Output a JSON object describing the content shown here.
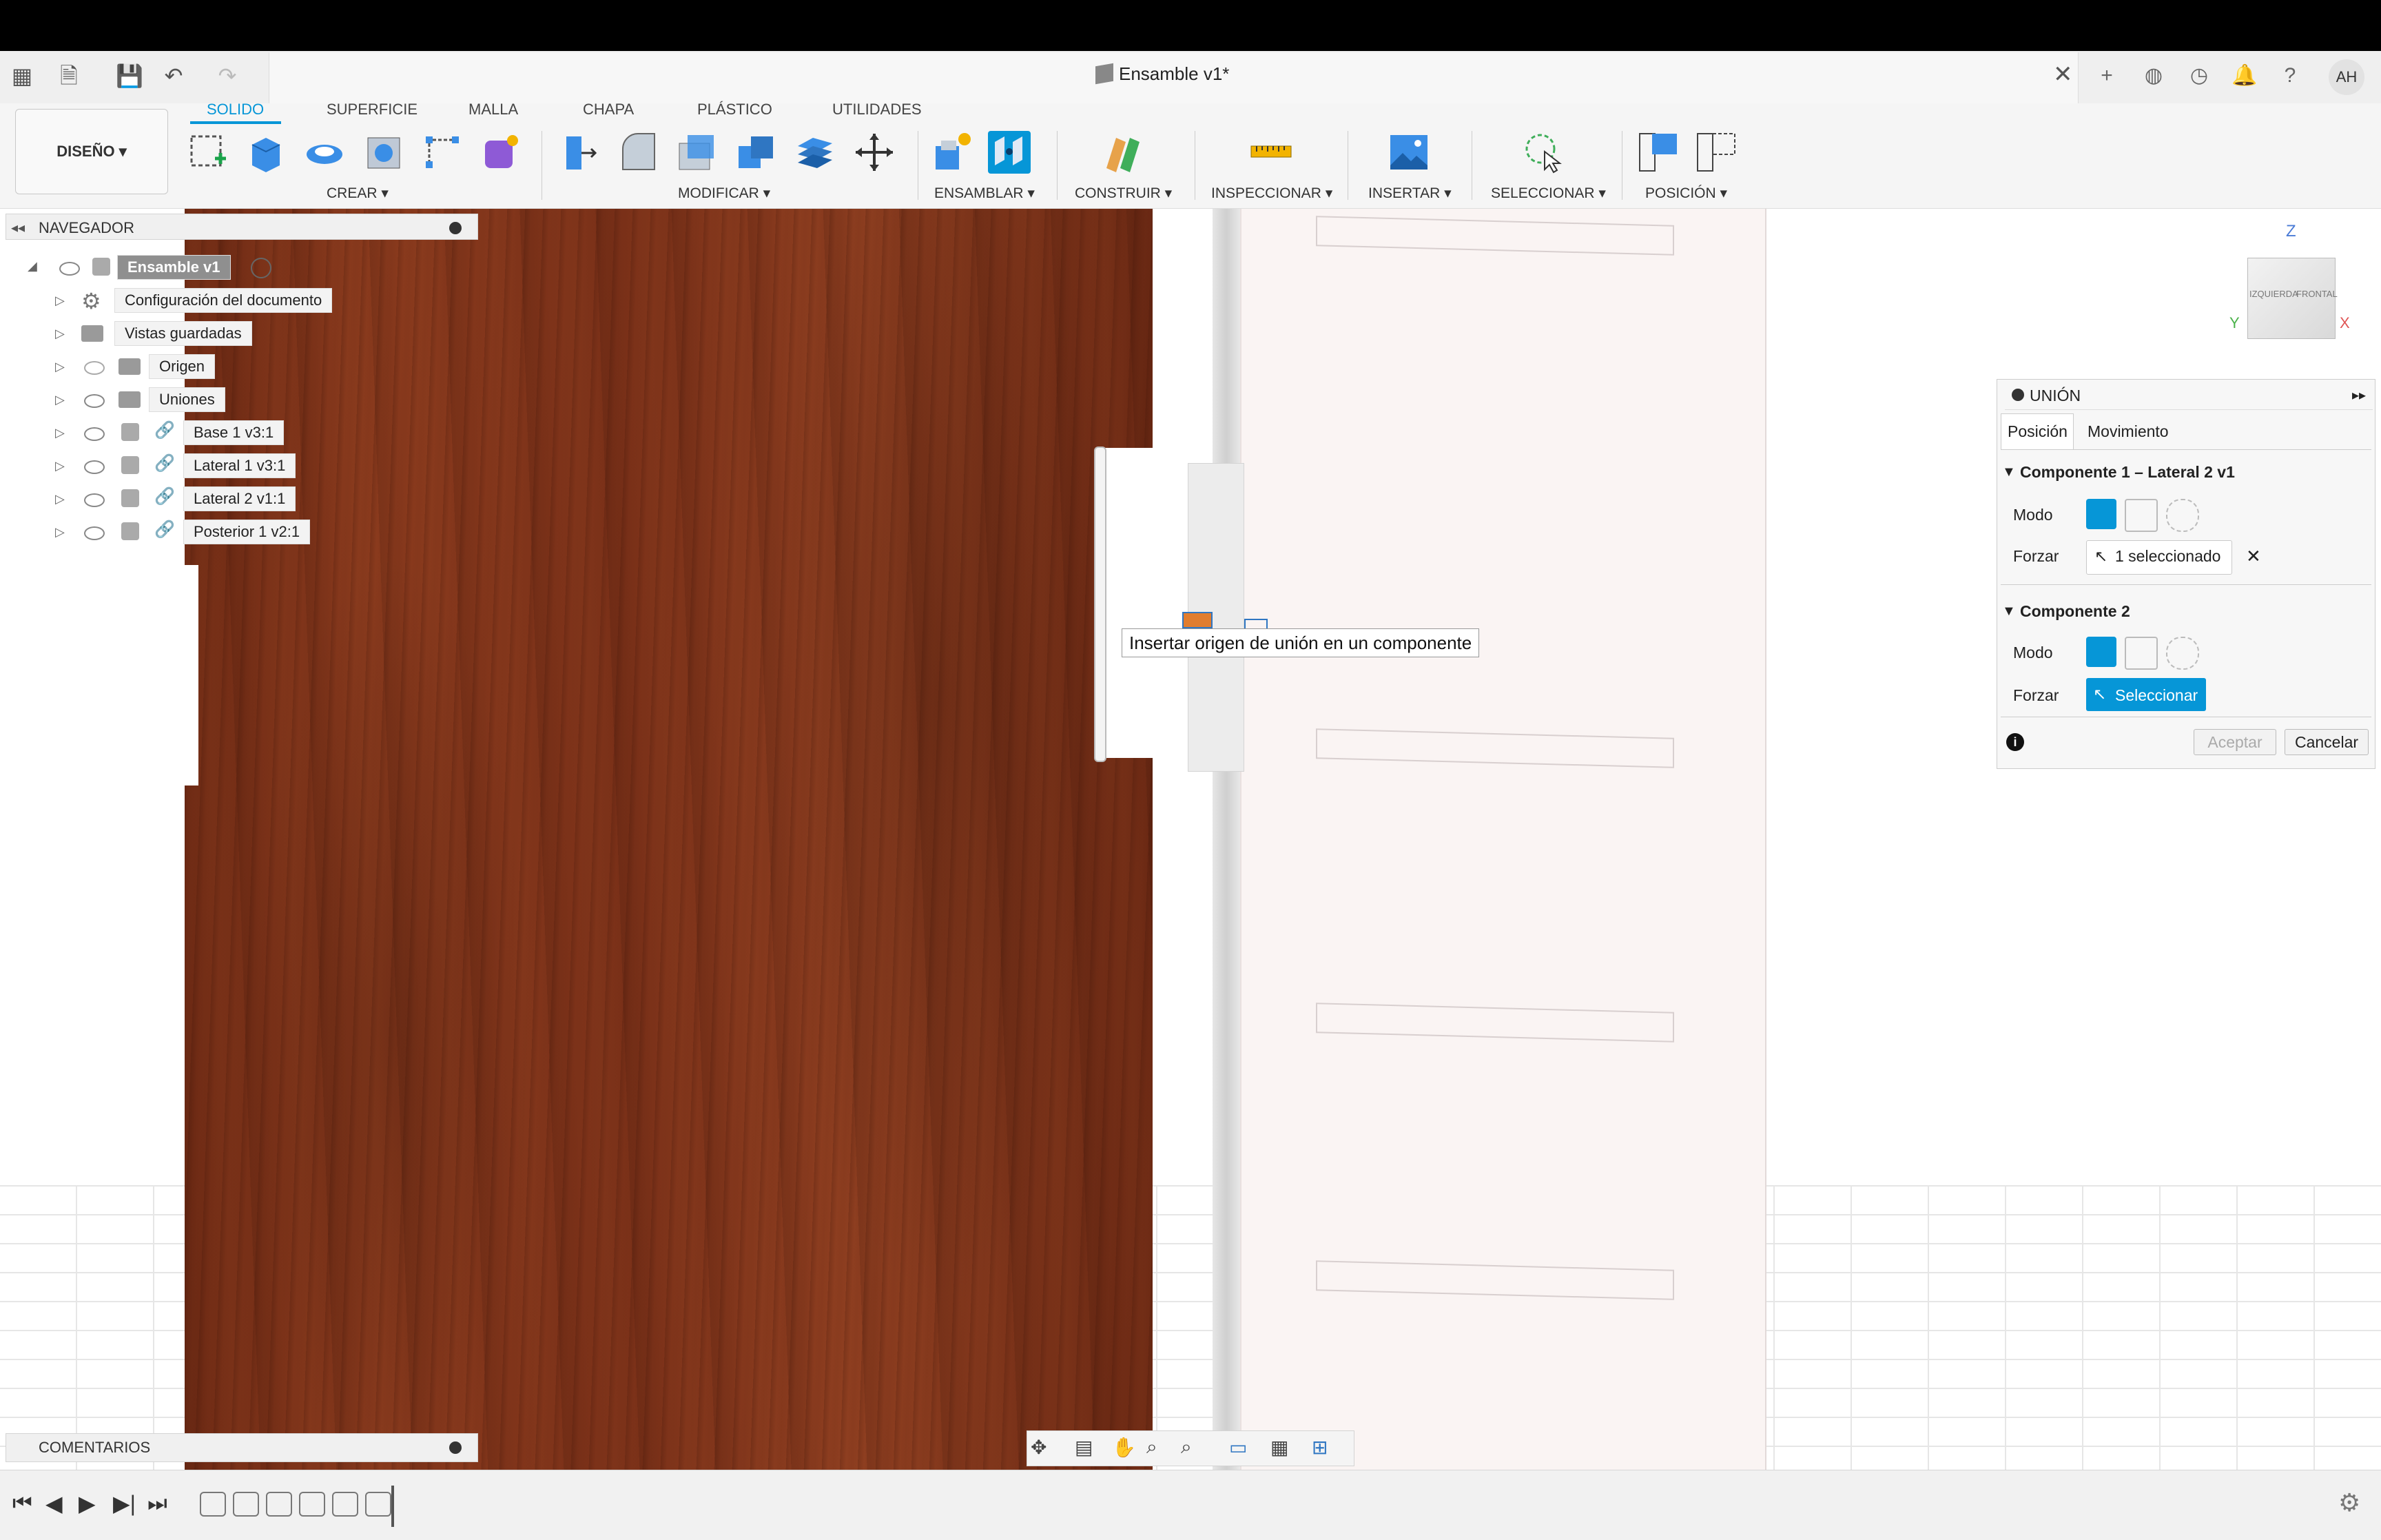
{
  "window": {
    "title": "Ensamble v1*"
  },
  "user": {
    "initials": "AH"
  },
  "toolbar": {
    "workspace": "DISEÑO ▾",
    "tabs": [
      "SOLIDO",
      "SUPERFICIE",
      "MALLA",
      "CHAPA",
      "PLÁSTICO",
      "UTILIDADES"
    ],
    "active_tab": "SOLIDO",
    "groups": [
      "CREAR ▾",
      "MODIFICAR ▾",
      "ENSAMBLAR ▾",
      "CONSTRUIR ▾",
      "INSPECCIONAR ▾",
      "INSERTAR ▾",
      "SELECCIONAR ▾",
      "POSICIÓN ▾"
    ]
  },
  "navigator": {
    "title": "NAVEGADOR",
    "items": [
      {
        "label": "Ensamble v1"
      },
      {
        "label": "Configuración del documento"
      },
      {
        "label": "Vistas guardadas"
      },
      {
        "label": "Origen"
      },
      {
        "label": "Uniones"
      },
      {
        "label": "Base 1 v3:1"
      },
      {
        "label": "Lateral 1 v3:1"
      },
      {
        "label": "Lateral 2 v1:1"
      },
      {
        "label": "Posterior 1 v2:1"
      }
    ]
  },
  "comments": {
    "title": "COMENTARIOS"
  },
  "tooltip": {
    "text": "Insertar origen de unión en un componente"
  },
  "join_panel": {
    "title": "UNIÓN",
    "tabs": [
      "Posición",
      "Movimiento"
    ],
    "component1": {
      "header": "Componente 1 – Lateral 2 v1",
      "mode_label": "Modo",
      "force_label": "Forzar",
      "force_value": "1 seleccionado"
    },
    "component2": {
      "header": "Componente 2",
      "mode_label": "Modo",
      "force_label": "Forzar",
      "force_value": "Seleccionar"
    },
    "ok": "Aceptar",
    "cancel": "Cancelar"
  },
  "viewcube": {
    "left": "IZQUIERDA",
    "front": "FRONTAL",
    "axis_z": "Z",
    "axis_x": "X",
    "axis_y": "Y"
  },
  "colors": {
    "accent": "#0696d7",
    "wood": "#7a3018"
  }
}
